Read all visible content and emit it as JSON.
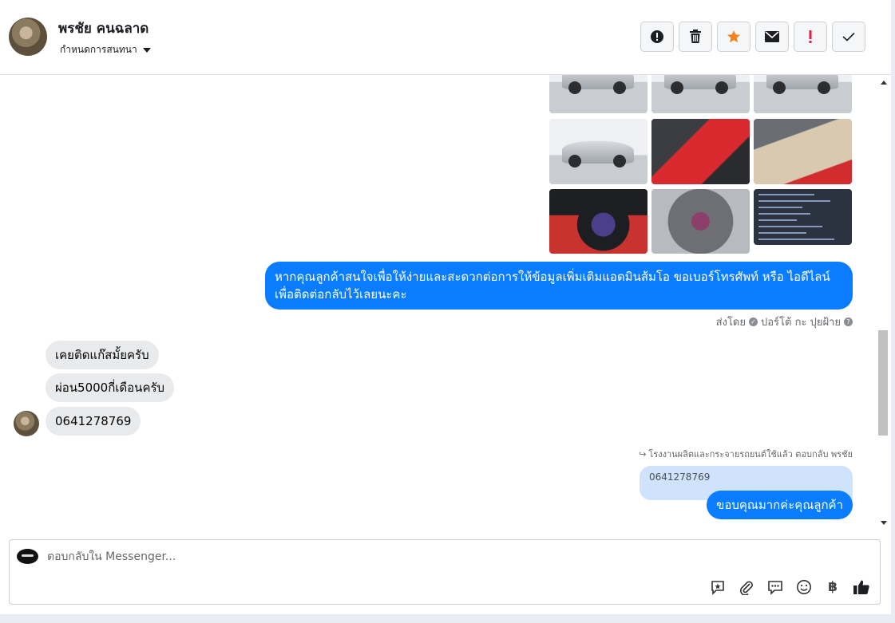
{
  "header": {
    "name": "พรชัย คนฉลาด",
    "subtitle": "กำหนดการสนทนา"
  },
  "actions": [
    {
      "name": "info",
      "icon": "exclamation-circle-icon"
    },
    {
      "name": "delete",
      "icon": "trash-icon"
    },
    {
      "name": "star",
      "icon": "star-icon"
    },
    {
      "name": "mail",
      "icon": "envelope-icon"
    },
    {
      "name": "important",
      "icon": "exclamation-icon"
    },
    {
      "name": "done",
      "icon": "check-icon"
    }
  ],
  "messages": {
    "outgoing_text": "หากคุณลูกค้าสนใจเพื่อให้ง่ายและสะดวกต่อการให้ข้อมูลเพิ่มเติมแอดมินส้มโอ ขอเบอร์โทรศัพท์ หรือ ไอดีไลน์เพื่อติดต่อกลับไว้เลยนะคะ",
    "sent_by_label": "ส่งโดย",
    "sent_by_name": "ปอร์โต้ กะ ปุยฝ้าย",
    "incoming": [
      "เคยติดแก๊สมั้ยครับ",
      "ผ่อน5000กี่เดือนครับ",
      "0641278769"
    ],
    "reply_meta": "โรงงานผลิตและกระจายรถยนต์ใช้แล้ว ตอบกลับ พรชัย",
    "quoted_text": "0641278769",
    "reply_text": "ขอบคุณมากค่ะคุณลูกค้า"
  },
  "composer": {
    "placeholder": "ตอบกลับใน Messenger...",
    "tools": [
      "sticker-icon",
      "attachment-icon",
      "chat-bubbles-icon",
      "emoji-icon",
      "baht-icon",
      "thumbs-up-icon"
    ],
    "baht_symbol": "฿"
  },
  "colors": {
    "outgoing": "#0a7cff",
    "incoming": "#e9eaec",
    "quoted": "#cfe3fc",
    "star": "#f5821f",
    "important": "#e41e3f"
  }
}
